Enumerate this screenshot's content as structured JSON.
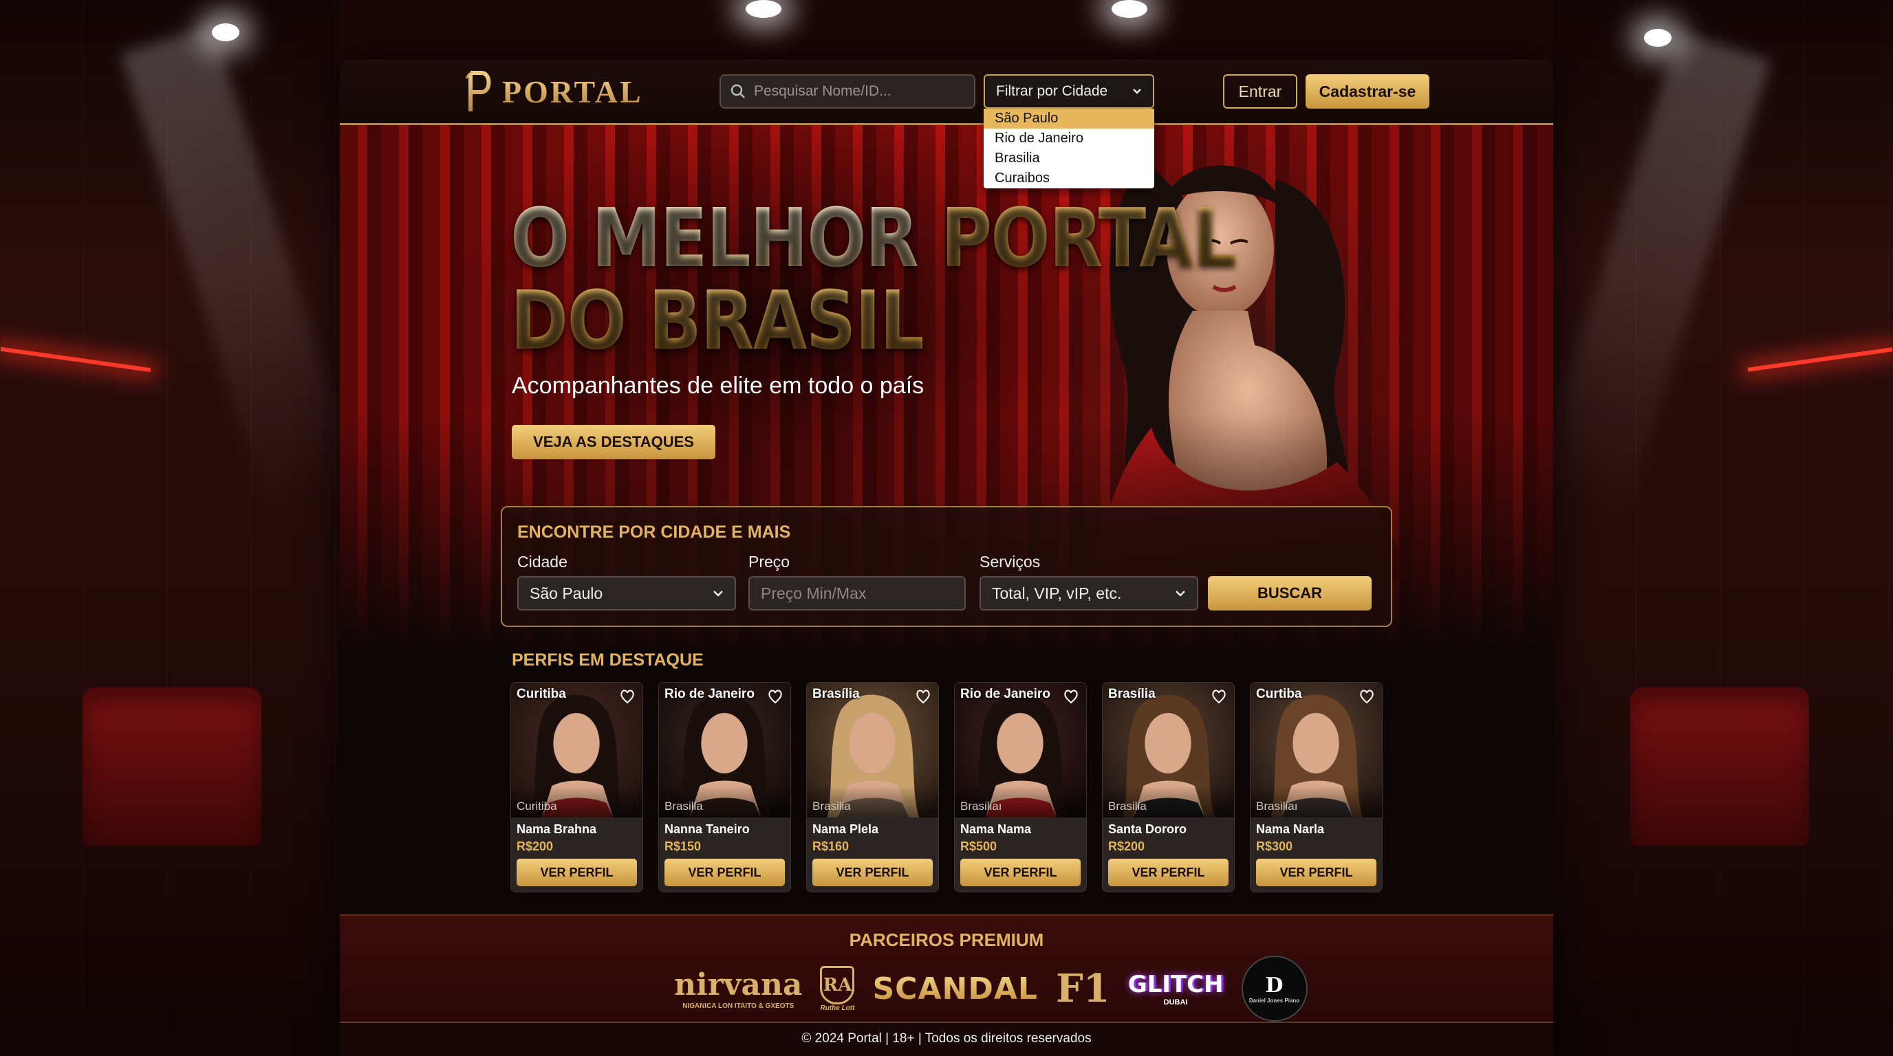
{
  "brand": {
    "name": "PORTAL"
  },
  "search": {
    "placeholder": "Pesquisar Nome/ID..."
  },
  "city_filter": {
    "label": "Filtrar por Cidade",
    "options": [
      "São Paulo",
      "Rio de Janeiro",
      "Brasilia",
      "Curaibos"
    ],
    "highlighted": "São Paulo"
  },
  "nav": {
    "login": "Entrar",
    "signup": "Cadastrar-se"
  },
  "hero": {
    "title_line1_a": "O MELHOR ",
    "title_line1_b": "PORTAL",
    "title_line2": "DO BRASIL",
    "subtitle": "Acompanhantes de elite em todo o país",
    "cta": "VEJA AS DESTAQUES"
  },
  "finder": {
    "title": "ENCONTRE POR CIDADE E MAIS",
    "city_label": "Cidade",
    "city_value": "São Paulo",
    "price_label": "Preço",
    "price_placeholder": "Preço Min/Max",
    "services_label": "Serviços",
    "services_value": "Total, VIP, vIP, etc.",
    "submit": "BUSCAR"
  },
  "featured": {
    "title": "PERFIS EM DESTAQUE",
    "profiles": [
      {
        "city_top": "Curitiba",
        "city_bottom": "Curitiba",
        "name": "Nama Brahna",
        "price": "R$200",
        "button": "VER PERFIL"
      },
      {
        "city_top": "Rio de Janeiro",
        "city_bottom": "Brasilla",
        "name": "Nanna Taneiro",
        "price": "R$150",
        "button": "VER PERFIL"
      },
      {
        "city_top": "Brasília",
        "city_bottom": "Brasilia",
        "name": "Nama Plela",
        "price": "R$160",
        "button": "VER PERFIL"
      },
      {
        "city_top": "Rio de Janeiro",
        "city_bottom": "Brasiliaı",
        "name": "Nama Nama",
        "price": "R$500",
        "button": "VER PERFIL"
      },
      {
        "city_top": "Brasília",
        "city_bottom": "Brasilia",
        "name": "Santa Dororo",
        "price": "R$200",
        "button": "VER PERFIL"
      },
      {
        "city_top": "Curtiba",
        "city_bottom": "Brasiliaı",
        "name": "Nama Narla",
        "price": "R$300",
        "button": "VER PERFIL"
      }
    ]
  },
  "partners": {
    "title": "PARCEIROS PREMIUM",
    "logos": [
      {
        "text": "nirvana",
        "sub": "NIGANICA LON ITAITO & GXEOTS"
      },
      {
        "text": "RA",
        "sub": "Ruthe Lott"
      },
      {
        "text": "SCANDAL",
        "sub": ""
      },
      {
        "text": "F1",
        "sub": ""
      },
      {
        "text": "GLITCH",
        "sub": "DUBAI"
      },
      {
        "text": "D",
        "sub": "Daniel Jones Piano"
      }
    ]
  },
  "footer": {
    "text": "© 2024 Portal | 18+ | Todos os direitos reservados"
  },
  "colors": {
    "gold": "#e2b461",
    "button_gold": "#c8953e",
    "curtain_red": "#b3120f"
  }
}
